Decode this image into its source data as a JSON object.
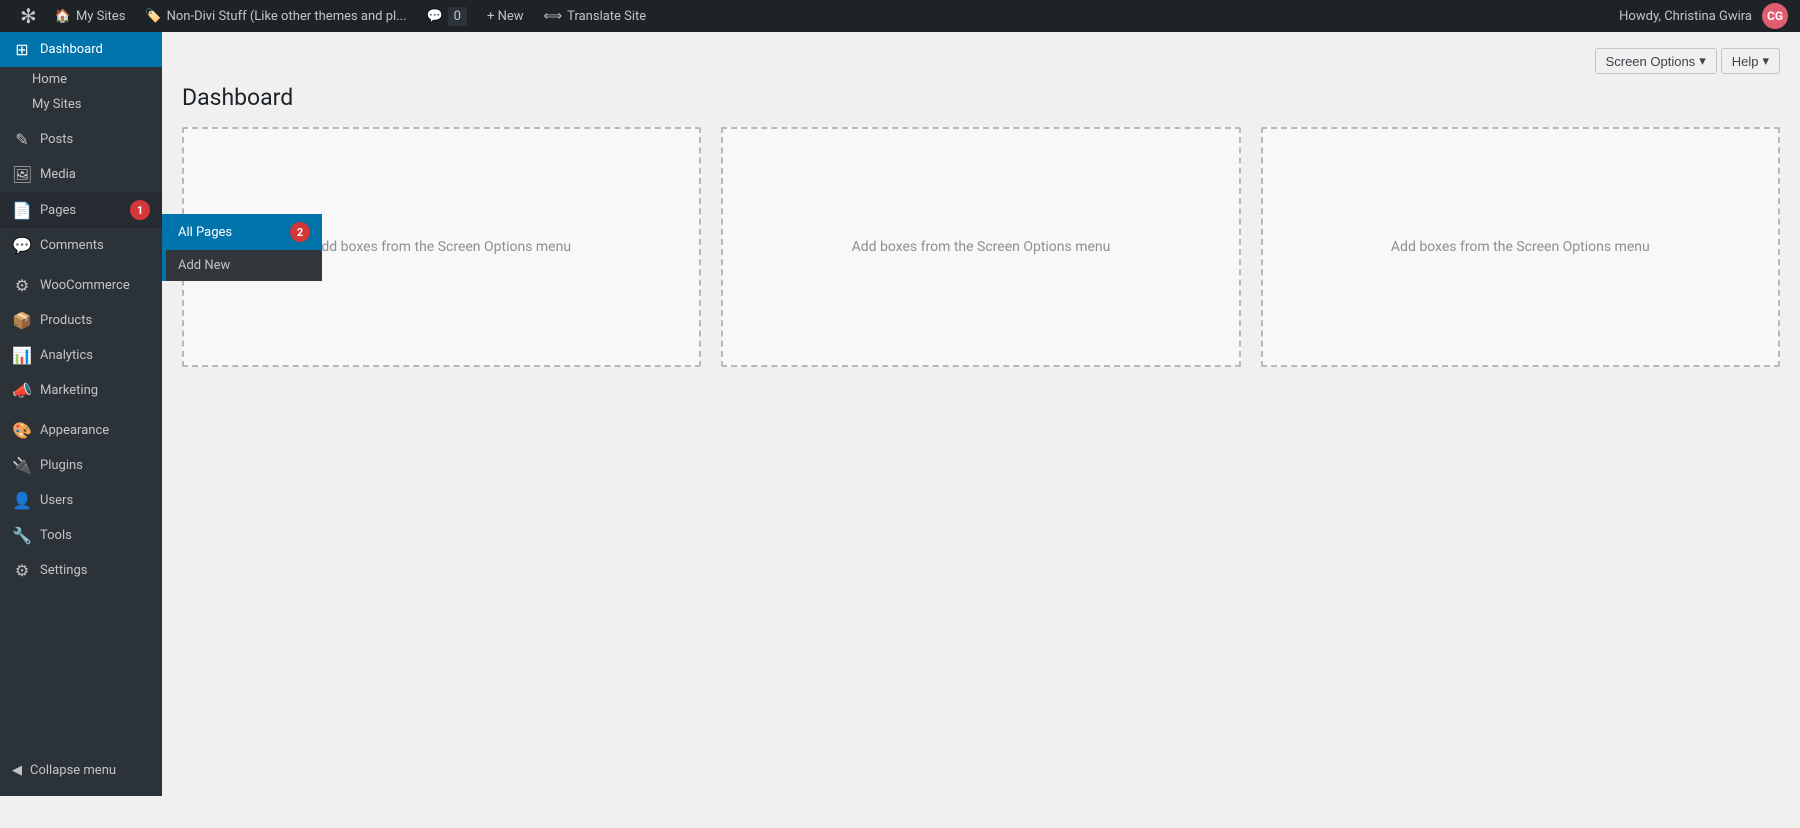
{
  "adminbar": {
    "logo_icon": "⊞",
    "my_sites_label": "My Sites",
    "site_title": "Non-Divi Stuff (Like other themes and pl...",
    "comment_count": "0",
    "new_label": "+ New",
    "translate_label": "Translate Site",
    "greeting": "Howdy, Christina Gwira"
  },
  "sidebar": {
    "dashboard_label": "Dashboard",
    "home_label": "Home",
    "my_sites_label": "My Sites",
    "posts_label": "Posts",
    "media_label": "Media",
    "pages_label": "Pages",
    "pages_badge": "1",
    "comments_label": "Comments",
    "woocommerce_label": "WooCommerce",
    "products_label": "Products",
    "analytics_label": "Analytics",
    "marketing_label": "Marketing",
    "appearance_label": "Appearance",
    "plugins_label": "Plugins",
    "users_label": "Users",
    "tools_label": "Tools",
    "settings_label": "Settings",
    "collapse_label": "Collapse menu",
    "submenu": {
      "all_pages_label": "All Pages",
      "all_pages_badge": "2",
      "add_new_label": "Add New"
    }
  },
  "header": {
    "screen_options_label": "Screen Options",
    "help_label": "Help",
    "page_title": "Dashboard"
  },
  "content": {
    "box1_text": "Add boxes from the Screen Options menu",
    "box2_text": "Add boxes from the Screen Options menu",
    "box3_text": "Add boxes from the Screen Options menu"
  }
}
